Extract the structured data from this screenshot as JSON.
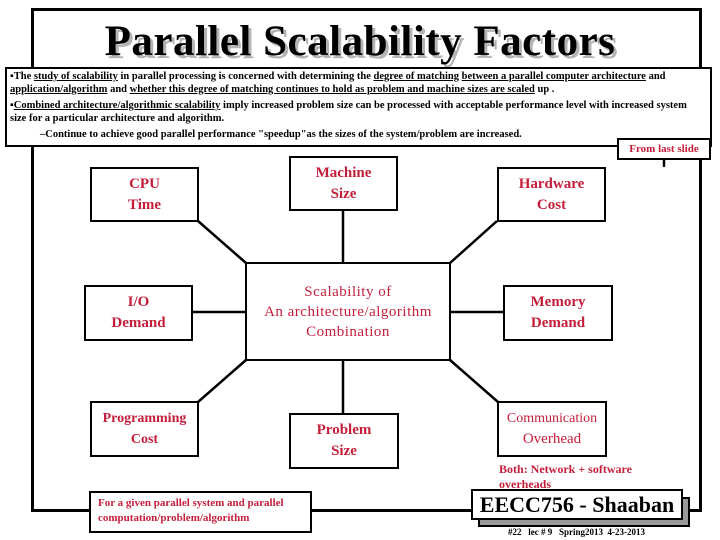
{
  "slide": {
    "title": "Parallel Scalability Factors",
    "intro": {
      "p1": {
        "bullet": "▪",
        "t1": "The ",
        "u1": "study of scalability",
        "t2": " in parallel processing is concerned with determining the ",
        "u2": "degree of matching",
        "t3": " ",
        "u3": "between a parallel computer architecture",
        "t4": " and ",
        "u4": "application/algorithm",
        "t5": " and ",
        "u5": "whether this degree of matching continues to hold as problem and machine sizes are scaled",
        "t6": " up ."
      },
      "p2": {
        "bullet": "▪",
        "u1": "Combined architecture/algorithmic scalability",
        "t1": " imply  increased problem size can be processed with acceptable performance level with increased system size for a particular architecture and algorithm."
      },
      "p3": "–Continue to achieve good parallel performance \"speedup\"as the sizes of the system/problem are increased."
    },
    "from_last_slide": "From last slide",
    "diagram": {
      "center": [
        "Scalability of",
        "An architecture/algorithm",
        "Combination"
      ],
      "nodes": {
        "cpu_time": [
          "CPU",
          "Time"
        ],
        "machine_size": [
          "Machine",
          "Size"
        ],
        "hardware_cost": [
          "Hardware",
          "Cost"
        ],
        "io_demand": [
          "I/O",
          "Demand"
        ],
        "memory_demand": [
          "Memory",
          "Demand"
        ],
        "programming_cost": [
          "Programming",
          "Cost"
        ],
        "problem_size": [
          "Problem",
          "Size"
        ],
        "communication_overhead": [
          "Communication",
          "Overhead"
        ]
      },
      "comm_note": [
        "Both: Network + software",
        "overheads"
      ]
    },
    "given_note": [
      "For a given parallel system and parallel",
      "computation/problem/algorithm"
    ],
    "badge": "EECC756 - Shaaban",
    "footer": "#22   lec # 9   Spring2013  4-23-2013",
    "colors": {
      "accent_text": "#c41e3a",
      "border": "#000000",
      "shadow": "#9a9a9a"
    }
  }
}
